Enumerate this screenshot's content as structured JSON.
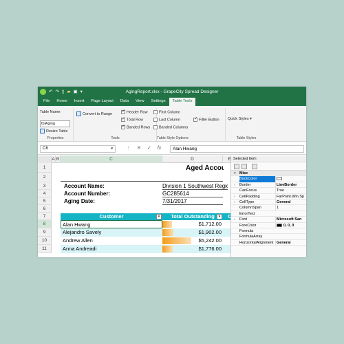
{
  "window": {
    "title": "AgingReport.xlsx - GrapeCity Spread Designer",
    "qa_icons": [
      "logo-icon",
      "undo-icon",
      "redo-icon",
      "new-file-icon",
      "open-folder-icon",
      "save-icon",
      "customize-icon"
    ],
    "accent": "#217346"
  },
  "tabs": [
    {
      "label": "File"
    },
    {
      "label": "Home"
    },
    {
      "label": "Insert"
    },
    {
      "label": "Page Layout"
    },
    {
      "label": "Data"
    },
    {
      "label": "View"
    },
    {
      "label": "Settings"
    },
    {
      "label": "Table Tools"
    }
  ],
  "ribbon": {
    "properties": {
      "table_name_label": "Table Name:",
      "table_name_value": "tblAging",
      "resize_label": "Resize Table",
      "group_label": "Properties"
    },
    "tools": {
      "convert_label": "Convert to Range",
      "group_label": "Tools"
    },
    "style_options": {
      "header_row": "Header Row",
      "total_row": "Total Row",
      "banded_rows": "Banded Rows",
      "first_column": "First Column",
      "last_column": "Last Column",
      "banded_columns": "Banded Columns",
      "filter_button": "Filter Button",
      "group_label": "Table Style Options"
    },
    "styles": {
      "quick_styles": "Quick Styles",
      "group_label": "Table Styles"
    }
  },
  "formula_bar": {
    "name_box": "C8",
    "cancel": "✕",
    "confirm": "✓",
    "fx": "fx",
    "value": "Alan Hwang"
  },
  "sheet": {
    "columns": [
      "A",
      "B",
      "C",
      "D",
      "E"
    ],
    "rows": [
      "1",
      "2",
      "3",
      "4",
      "5",
      "6",
      "7",
      "8",
      "9",
      "10",
      "11"
    ],
    "title": "Aged Accou",
    "account_name_label": "Account Name:",
    "account_name_value": "Division 1 Southwest Region",
    "account_number_label": "Account Number:",
    "account_number_value": "GC285614",
    "aging_date_label": "Aging Date:",
    "aging_date_value": "7/31/2017",
    "table": {
      "headers": [
        "Customer",
        "Total Outstanding",
        "C"
      ],
      "rows": [
        {
          "customer": "Alan Hwang",
          "amount": "$1,712.00",
          "fill": 0.16
        },
        {
          "customer": "Alejandro Savely",
          "amount": "$1,902.00",
          "fill": 0.18
        },
        {
          "customer": "Andrew Allen",
          "amount": "$5,242.00",
          "fill": 0.48
        },
        {
          "customer": "Anna Andreadi",
          "amount": "$1,776.00",
          "fill": 0.17
        }
      ],
      "header_color": "#15b4c4",
      "bar_color": "#f59c1a"
    }
  },
  "panel": {
    "title": "Selected Item",
    "properties": [
      {
        "name": "Misc",
        "value": "",
        "category": true
      },
      {
        "name": "BackColor",
        "value": "",
        "selected": true,
        "swatch": "#ffffff"
      },
      {
        "name": "Border",
        "value": "LineBorder",
        "bold": true,
        "expandable": true
      },
      {
        "name": "CanFocus",
        "value": "True"
      },
      {
        "name": "CellPadding",
        "value": "FarPoint.Win.Sp",
        "expandable": true
      },
      {
        "name": "CellType",
        "value": "General",
        "bold": true,
        "expandable": true
      },
      {
        "name": "ColumnSpan",
        "value": "1"
      },
      {
        "name": "ErrorText",
        "value": ""
      },
      {
        "name": "Font",
        "value": "Microsoft San",
        "bold": true,
        "expandable": true
      },
      {
        "name": "ForeColor",
        "value": "0, 0, 0",
        "bold": true,
        "swatch": "#000000"
      },
      {
        "name": "Formula",
        "value": ""
      },
      {
        "name": "FormulaArray",
        "value": ""
      },
      {
        "name": "HorizontalAlignment",
        "value": "General",
        "bold": true
      }
    ]
  }
}
